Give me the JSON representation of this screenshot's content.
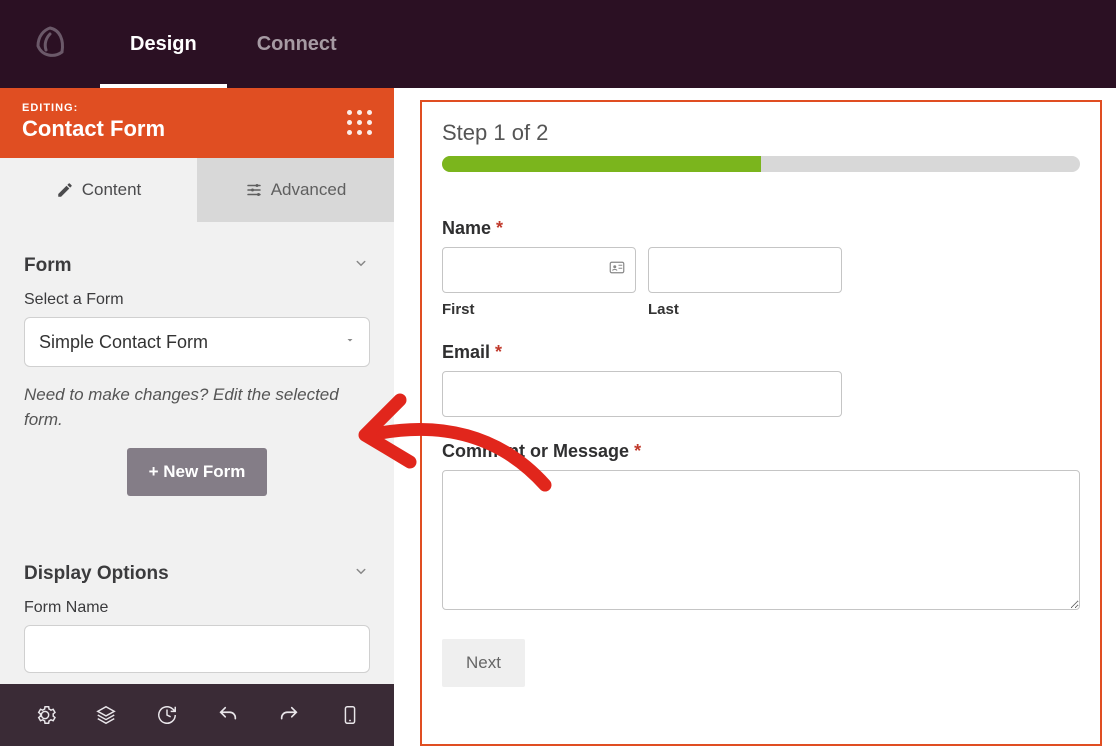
{
  "nav": {
    "design": "Design",
    "connect": "Connect"
  },
  "editing": {
    "label": "EDITING:",
    "title": "Contact Form"
  },
  "subtabs": {
    "content": "Content",
    "advanced": "Advanced"
  },
  "form_section": {
    "title": "Form",
    "select_label": "Select a Form",
    "selected_form": "Simple Contact Form",
    "help_text": "Need to make changes? Edit the selected form.",
    "new_form_btn": "+ New Form"
  },
  "display_section": {
    "title": "Display Options",
    "form_name_label": "Form Name"
  },
  "preview": {
    "step_label": "Step 1 of 2",
    "progress_percent": 50,
    "name": {
      "label": "Name",
      "first": "First",
      "last": "Last"
    },
    "email": {
      "label": "Email"
    },
    "comment": {
      "label": "Comment or Message"
    },
    "next_btn": "Next"
  },
  "colors": {
    "brand_orange": "#e04e22",
    "progress_green": "#7bb51d"
  }
}
